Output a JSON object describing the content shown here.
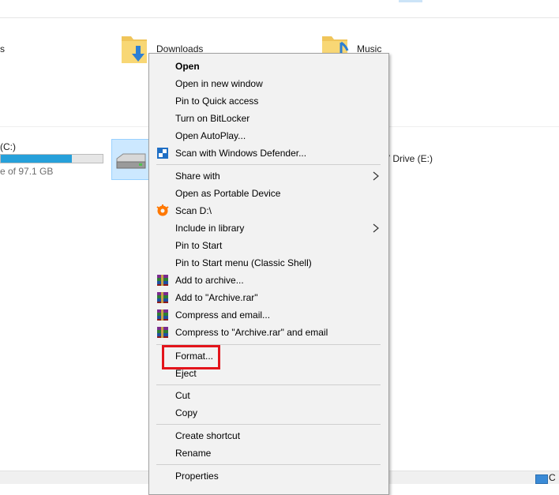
{
  "explorer": {
    "downloads_label": "Downloads",
    "music_label": "Music",
    "partial_left_label": "s",
    "drive_c_label": "(C:)",
    "drive_c_subtext": "e of 97.1 GB",
    "drive_c_fill_fraction": 0.7,
    "drive_e_label": "V Drive (E:)",
    "status_text": "C"
  },
  "menu": {
    "open": "Open",
    "open_new_window": "Open in new window",
    "pin_quick_access": "Pin to Quick access",
    "turn_on_bitlocker": "Turn on BitLocker",
    "open_autoplay": "Open AutoPlay...",
    "scan_defender": "Scan with Windows Defender...",
    "share_with": "Share with",
    "open_portable": "Open as Portable Device",
    "scan_d": "Scan D:\\",
    "include_library": "Include in library",
    "pin_start": "Pin to Start",
    "pin_start_classic": "Pin to Start menu (Classic Shell)",
    "add_archive": "Add to archive...",
    "add_archive_rar": "Add to \"Archive.rar\"",
    "compress_email": "Compress and email...",
    "compress_rar_email": "Compress to \"Archive.rar\" and email",
    "format": "Format...",
    "eject": "Eject",
    "cut": "Cut",
    "copy": "Copy",
    "create_shortcut": "Create shortcut",
    "rename": "Rename",
    "properties": "Properties"
  },
  "icons": {
    "defender": "shield-icon",
    "avast": "avast-icon",
    "winrar": "winrar-icon",
    "submenu": "chevron-right-icon"
  },
  "colors": {
    "highlight_border": "#e3141b",
    "drive_bar_fill": "#26a0da",
    "selection": "#cce8ff"
  }
}
